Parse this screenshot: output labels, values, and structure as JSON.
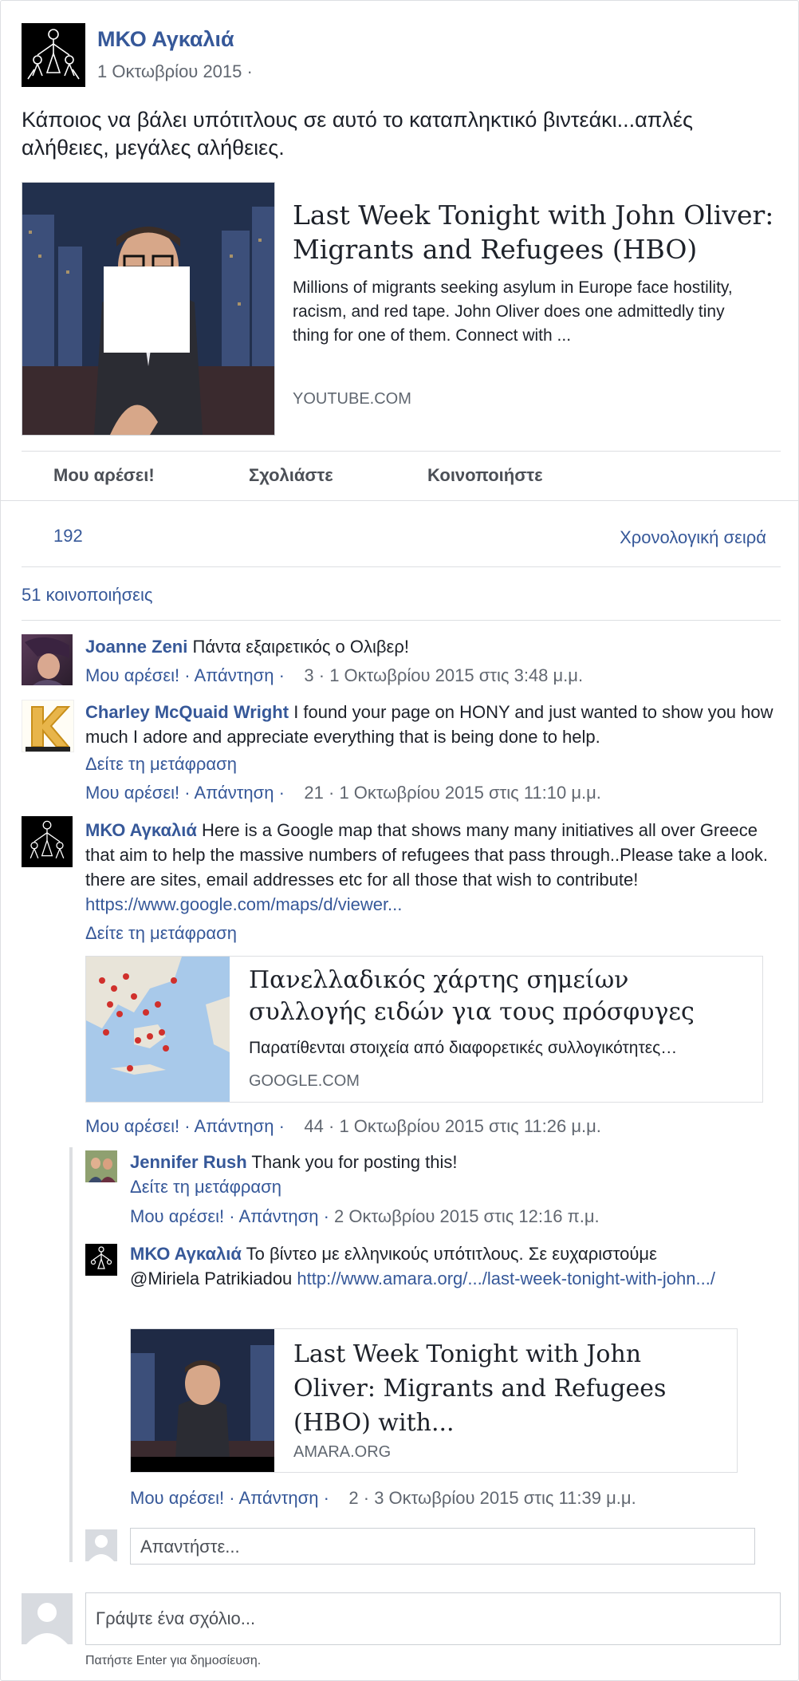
{
  "post": {
    "page_name": "ΜΚΟ Αγκαλιά",
    "date": "1 Οκτωβρίου 2015 ·",
    "text": "Κάποιος να βάλει υπότιτλους σε αυτό το καταπληκτικό βιντεάκι...απλές αλήθειες, μεγάλες αλήθειες.",
    "link": {
      "title": "Last Week Tonight with John Oliver: Migrants and Refugees (HBO)",
      "description": "Millions of migrants seeking asylum in Europe face hostility, racism, and red tape. John Oliver does one admittedly tiny thing for one of them. Connect with ...",
      "domain": "YOUTUBE.COM"
    }
  },
  "actions": {
    "like": "Μου αρέσει!",
    "comment": "Σχολιάστε",
    "share": "Κοινοποιήστε"
  },
  "stats": {
    "likes": "192",
    "order": "Χρονολογική σειρά",
    "shares": "51 κοινοποιήσεις"
  },
  "comments": [
    {
      "author": "Joanne Zeni",
      "text": "Πάντα εξαιρετικός ο Ολιβερ!",
      "like": "Μου αρέσει!",
      "reply": "Απάντηση",
      "likes": "3",
      "time": "1 Οκτωβρίου 2015 στις 3:48 μ.μ."
    },
    {
      "author": "Charley McQuaid Wright",
      "text": "I found your page on HONY and just wanted to show you how much I adore and appreciate everything that is being done to help.",
      "translate": "Δείτε τη μετάφραση",
      "like": "Μου αρέσει!",
      "reply": "Απάντηση",
      "likes": "21",
      "time": "1 Οκτωβρίου 2015 στις 11:10 μ.μ."
    },
    {
      "author": "ΜΚΟ Αγκαλιά",
      "text": "Here is a Google map that shows many many initiatives all over Greece that aim to help the massive numbers of refugees that pass through..Please take a look. there are sites, email addresses etc for all those that wish to contribute!",
      "url": "https://www.google.com/maps/d/viewer...",
      "translate": "Δείτε τη μετάφραση",
      "link": {
        "title": "Πανελλαδικός χάρτης σημείων συλλογής ειδών για τους πρόσφυγες",
        "description": "Παρατίθενται στοιχεία από διαφορετικές συλλογικότητες…",
        "domain": "GOOGLE.COM"
      },
      "like": "Μου αρέσει!",
      "reply": "Απάντηση",
      "likes": "44",
      "time": "1 Οκτωβρίου 2015 στις 11:26 μ.μ."
    }
  ],
  "replies": [
    {
      "author": "Jennifer Rush",
      "text": "Thank you for posting this!",
      "translate": "Δείτε τη μετάφραση",
      "like": "Μου αρέσει!",
      "reply": "Απάντηση",
      "time": "2 Οκτωβρίου 2015 στις 12:16 π.μ."
    },
    {
      "author": "ΜΚΟ Αγκαλιά",
      "text": "Το βίντεο με ελληνικούς υπότιτλους. Σε ευχαριστούμε @Miriela Patrikiadou",
      "url": "http://www.amara.org/.../last-week-tonight-with-john.../",
      "link": {
        "title": "Last Week Tonight with John Oliver: Migrants and Refugees (HBO) with...",
        "domain": "AMARA.ORG"
      },
      "like": "Μου αρέσει!",
      "reply": "Απάντηση",
      "likes": "2",
      "time": "3 Οκτωβρίου 2015 στις 11:39 μ.μ."
    }
  ],
  "reply_input": {
    "placeholder": "Απαντήστε..."
  },
  "comment_input": {
    "placeholder": "Γράψτε ένα σχόλιο...",
    "hint": "Πατήστε Enter για δημοσίευση."
  },
  "colors": {
    "link": "#365899",
    "divider": "#dddfe2",
    "text": "#1d2129",
    "muted": "#616770"
  }
}
